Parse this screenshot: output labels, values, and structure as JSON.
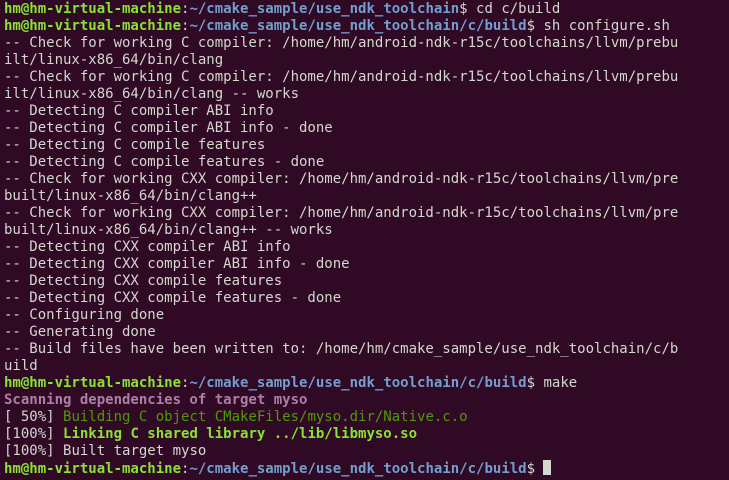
{
  "terminal": {
    "colors": {
      "background": "#300a24",
      "foreground": "#d3d7cf",
      "prompt_user": "#8ae234",
      "prompt_path": "#729fcf",
      "scan": "#ad7fa8",
      "build_object": "#4e9a06",
      "link_library": "#8ae234"
    },
    "prompt_user": "hm@hm-virtual-machine",
    "prompt_colon": ":",
    "prompt_path_1": "~/cmake_sample/use_ndk_toolchain",
    "prompt_dollar_1": "$ ",
    "command_1": "cd c/build",
    "prompt_path_2": "~/cmake_sample/use_ndk_toolchain/c/build",
    "prompt_dollar_2": "$ ",
    "command_2": "sh configure.sh",
    "configure_output": [
      "-- Check for working C compiler: /home/hm/android-ndk-r15c/toolchains/llvm/prebu",
      "ilt/linux-x86_64/bin/clang",
      "-- Check for working C compiler: /home/hm/android-ndk-r15c/toolchains/llvm/prebu",
      "ilt/linux-x86_64/bin/clang -- works",
      "-- Detecting C compiler ABI info",
      "-- Detecting C compiler ABI info - done",
      "-- Detecting C compile features",
      "-- Detecting C compile features - done",
      "-- Check for working CXX compiler: /home/hm/android-ndk-r15c/toolchains/llvm/pre",
      "built/linux-x86_64/bin/clang++",
      "-- Check for working CXX compiler: /home/hm/android-ndk-r15c/toolchains/llvm/pre",
      "built/linux-x86_64/bin/clang++ -- works",
      "-- Detecting CXX compiler ABI info",
      "-- Detecting CXX compiler ABI info - done",
      "-- Detecting CXX compile features",
      "-- Detecting CXX compile features - done",
      "-- Configuring done",
      "-- Generating done",
      "-- Build files have been written to: /home/hm/cmake_sample/use_ndk_toolchain/c/b",
      "uild"
    ],
    "prompt_path_3": "~/cmake_sample/use_ndk_toolchain/c/build",
    "prompt_dollar_3": "$ ",
    "command_3": "make",
    "scan_line": "Scanning dependencies of target myso",
    "build_pct_1": "[ 50%] ",
    "build_text_1": "Building C object CMakeFiles/myso.dir/Native.c.o",
    "build_pct_2": "[100%] ",
    "build_text_2": "Linking C shared library ../lib/libmyso.so",
    "build_pct_3": "[100%] ",
    "build_text_3": "Built target myso",
    "prompt_path_4": "~/cmake_sample/use_ndk_toolchain/c/build",
    "prompt_dollar_4": "$ "
  }
}
